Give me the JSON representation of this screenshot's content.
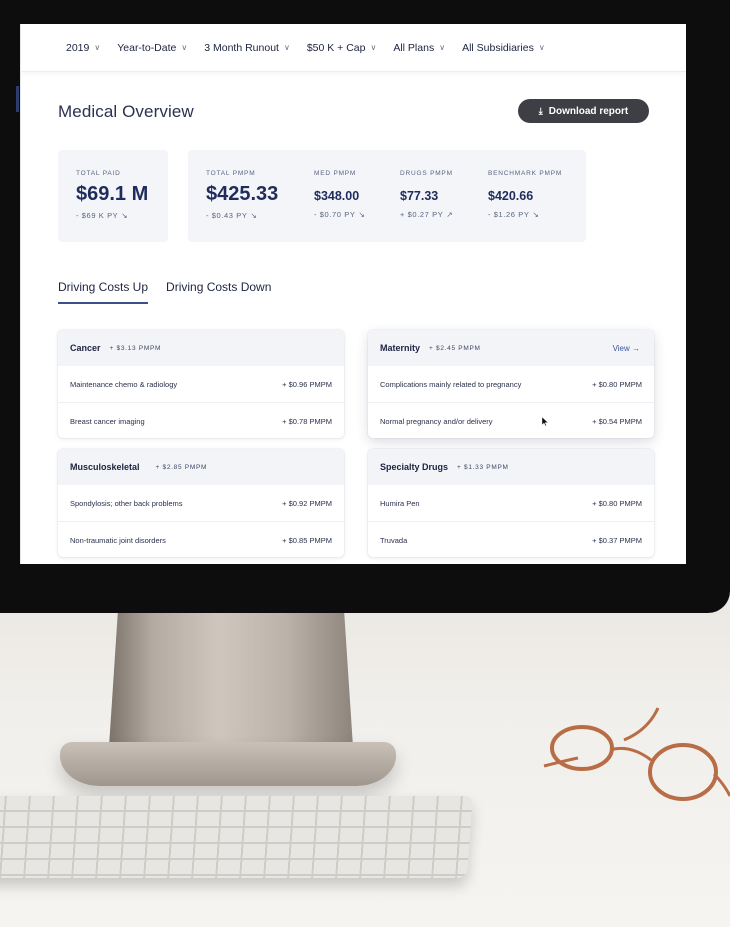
{
  "filters": [
    {
      "label": "2019"
    },
    {
      "label": "Year-to-Date"
    },
    {
      "label": "3 Month Runout"
    },
    {
      "label": "$50 K + Cap"
    },
    {
      "label": "All Plans"
    },
    {
      "label": "All Subsidiaries"
    }
  ],
  "page": {
    "title": "Medical Overview",
    "download_label": "Download report"
  },
  "stats": {
    "total_paid": {
      "label": "TOTAL PAID",
      "value": "$69.1 M",
      "change": "- $69 K PY",
      "direction": "down"
    },
    "total_pmpm": {
      "label": "TOTAL PMPM",
      "value": "$425.33",
      "change": "- $0.43 PY",
      "direction": "down"
    },
    "med_pmpm": {
      "label": "MED PMPM",
      "value": "$348.00",
      "change": "- $0.70 PY",
      "direction": "down"
    },
    "drugs_pmpm": {
      "label": "DRUGS PMPM",
      "value": "$77.33",
      "change": "+ $0.27 PY",
      "direction": "up"
    },
    "benchmark_pmpm": {
      "label": "BENCHMARK PMPM",
      "value": "$420.66",
      "change": "- $1.26 PY",
      "direction": "down"
    }
  },
  "tabs": [
    {
      "label": "Driving Costs Up",
      "active": true
    },
    {
      "label": "Driving Costs Down",
      "active": false
    }
  ],
  "cards": {
    "cancer": {
      "title": "Cancer",
      "delta": "+ $3.13 PMPM",
      "rows": [
        {
          "name": "Maintenance chemo & radiology",
          "value": "+ $0.96 PMPM"
        },
        {
          "name": "Breast cancer imaging",
          "value": "+ $0.78 PMPM"
        }
      ]
    },
    "maternity": {
      "title": "Maternity",
      "delta": "+ $2.45 PMPM",
      "view_label": "View →",
      "rows": [
        {
          "name": "Complications mainly related to pregnancy",
          "value": "+ $0.80 PMPM"
        },
        {
          "name": "Normal pregnancy and/or delivery",
          "value": "+ $0.54 PMPM"
        }
      ]
    },
    "musculoskeletal": {
      "title": "Musculoskeletal",
      "delta": "+ $2.85 PMPM",
      "rows": [
        {
          "name": "Spondylosis; other back problems",
          "value": "+ $0.92 PMPM"
        },
        {
          "name": "Non-traumatic joint disorders",
          "value": "+ $0.85 PMPM"
        }
      ]
    },
    "specialty_drugs": {
      "title": "Specialty Drugs",
      "delta": "+ $1.33 PMPM",
      "rows": [
        {
          "name": "Humira Pen",
          "value": "+ $0.80 PMPM"
        },
        {
          "name": "Truvada",
          "value": "+ $0.37 PMPM"
        }
      ]
    }
  },
  "colors": {
    "accent": "#2d3c6e",
    "button": "#3d3f45",
    "stat_value": "#1f2c5c",
    "link": "#3c57a0"
  },
  "icons": {
    "filter_chevron": "chevron-down-icon",
    "download": "download-icon",
    "trend_down": "arrow-down-right-icon",
    "trend_up": "arrow-up-right-icon",
    "cursor": "mouse-pointer-icon"
  }
}
